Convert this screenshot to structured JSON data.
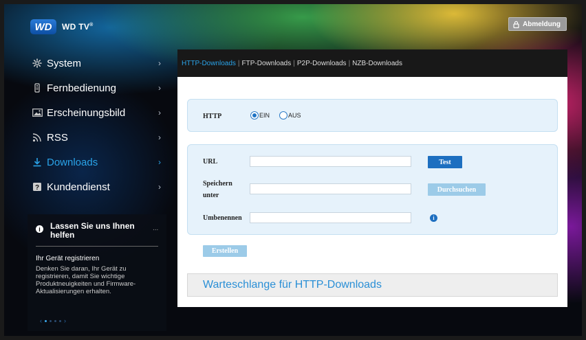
{
  "header": {
    "logo_badge": "WD",
    "logo_text": "WD TV",
    "logo_sup": "®",
    "logout_label": "Abmeldung"
  },
  "sidebar": {
    "items": [
      {
        "label": "System",
        "icon": "gear-icon"
      },
      {
        "label": "Fernbedienung",
        "icon": "remote-icon"
      },
      {
        "label": "Erscheinungsbild",
        "icon": "image-icon"
      },
      {
        "label": "RSS",
        "icon": "rss-icon"
      },
      {
        "label": "Downloads",
        "icon": "download-icon",
        "active": true
      },
      {
        "label": "Kundendienst",
        "icon": "help-icon"
      }
    ],
    "chevron": "›"
  },
  "help": {
    "title": "Lassen Sie uns Ihnen helfen",
    "more": "...",
    "subtitle": "Ihr Gerät registrieren",
    "text": "Denken Sie daran, Ihr Gerät zu registrieren, damit Sie wichtige Produktneuigkeiten und Firmware-Aktualisierungen erhalten.",
    "pager_prev": "‹",
    "pager_next": "›",
    "pages": 4,
    "current_page": 1
  },
  "tabs": [
    {
      "label": "HTTP-Downloads",
      "active": true
    },
    {
      "label": "FTP-Downloads"
    },
    {
      "label": "P2P-Downloads"
    },
    {
      "label": "NZB-Downloads"
    }
  ],
  "form": {
    "http_label": "HTTP",
    "option_on": "EIN",
    "option_off": "AUS",
    "selected": "EIN",
    "url_label": "URL",
    "url_value": "",
    "test_label": "Test",
    "save_label_line1": "Speichern",
    "save_label_line2": "unter",
    "save_value": "",
    "browse_label": "Durchsuchen",
    "rename_label": "Umbenennen",
    "rename_value": "",
    "create_label": "Erstellen"
  },
  "queue_title": "Warteschlange für HTTP-Downloads",
  "colors": {
    "accent": "#2aa3e8",
    "button_primary": "#1d6fc0",
    "button_disabled": "#9ccbe8",
    "box_bg": "#e6f2fb"
  }
}
